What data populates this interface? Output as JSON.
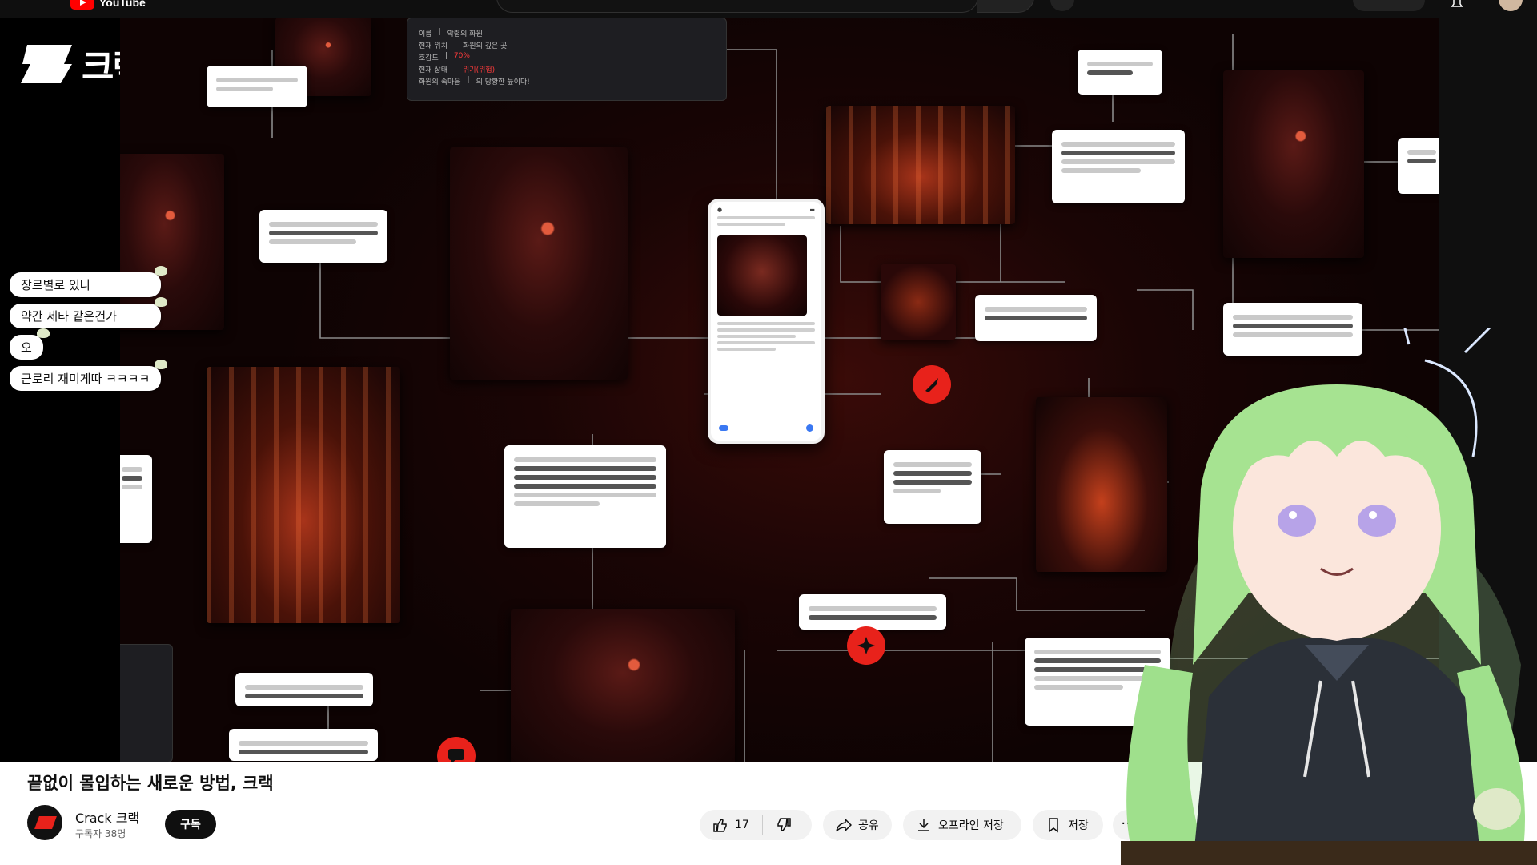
{
  "youtube": {
    "logo_text": "YouTube"
  },
  "crack_logo": {
    "text": "크랙"
  },
  "chat": {
    "messages": [
      "장르별로 있나",
      "약간 제타 같은건가",
      "오",
      "근로리 재미게따 ㅋㅋㅋㅋ"
    ]
  },
  "video_overlay": {
    "info_panel": {
      "rows": [
        {
          "k": "이름",
          "v": "악령의 화원"
        },
        {
          "k": "현재 위치",
          "v": "화원의 깊은 곳"
        },
        {
          "k": "호감도",
          "v": "70%"
        },
        {
          "k": "현재 상태",
          "v": "위기(위험)"
        },
        {
          "k": "화원의 속마음",
          "v": "의 당황한 늪이다!"
        }
      ]
    }
  },
  "video": {
    "title": "끝없이 몰입하는 새로운 방법, 크랙",
    "channel": "Crack 크랙",
    "subscribers": "구독자 38명",
    "subscribe_label": "구독"
  },
  "actions": {
    "like_count": "17",
    "share": "공유",
    "download": "오프라인 저장",
    "save": "저장",
    "more": "···"
  },
  "colors": {
    "accent_red": "#e8221b",
    "youtube_red": "#ff0000",
    "subscribe_bg": "#0f0f0f",
    "pill_bg": "#f2f2f2"
  }
}
